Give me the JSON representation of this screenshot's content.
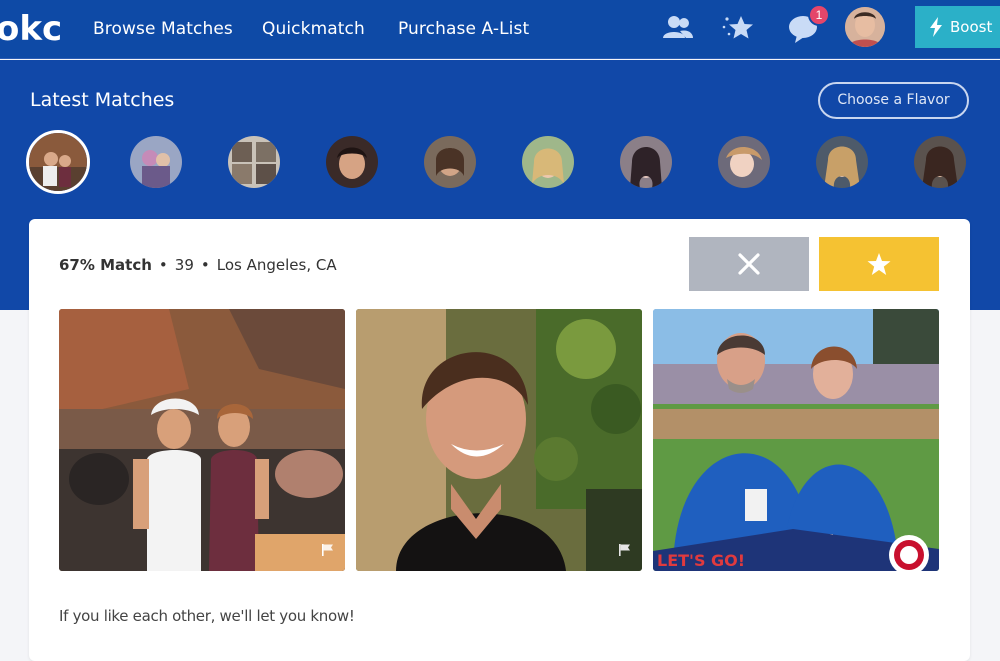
{
  "nav": {
    "logo_text": "okc",
    "links": [
      "Browse Matches",
      "Quickmatch",
      "Purchase A-List"
    ],
    "icons": [
      "people-icon",
      "stars-icon",
      "messages-icon"
    ],
    "message_badge": "1",
    "boost_label": "Boost"
  },
  "latest": {
    "title": "Latest Matches",
    "flavor_button": "Choose a Flavor",
    "thumbnails": [
      "match-1",
      "match-2",
      "match-3",
      "match-4",
      "match-5",
      "match-6",
      "match-7",
      "match-8",
      "match-9",
      "match-10"
    ]
  },
  "profile": {
    "match_percent": "67% Match",
    "age": "39",
    "location": "Los Angeles, CA",
    "photo3_caption": "LET'S GO!",
    "footnote": "If you like each other, we'll let you know!"
  },
  "colors": {
    "nav_bg": "#0e4aa6",
    "band_bg": "#1148a8",
    "boost": "#2bb0c8",
    "pass": "#b0b5bf",
    "like": "#f5c232",
    "badge": "#e5466a"
  }
}
